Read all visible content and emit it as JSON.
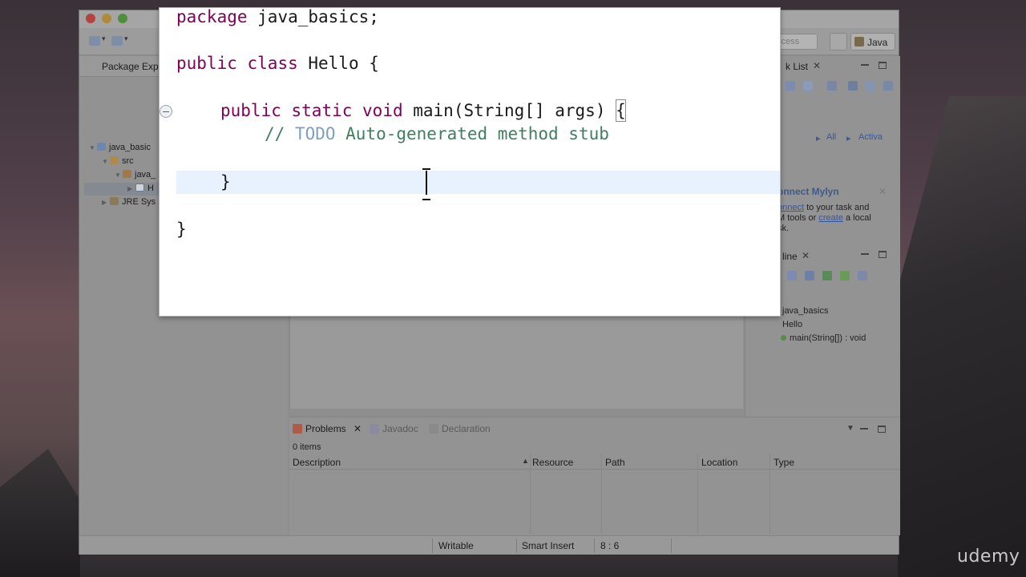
{
  "code": {
    "line1": {
      "keyword": "package",
      "rest": " java_basics;"
    },
    "line2": {
      "kw1": "public",
      "kw2": "class",
      "rest": " Hello {"
    },
    "line3": {
      "kw1": "public",
      "kw2": "static",
      "kw3": "void",
      "rest": " main(String[] args) ",
      "brace": "{"
    },
    "line4": {
      "prefix": "// ",
      "todo": "TODO",
      "rest": " Auto-generated method stub"
    },
    "line5": "}",
    "line6": "}"
  },
  "package_explorer": {
    "tab_label": "Package Expl",
    "items": [
      "java_basic",
      "src",
      "java_",
      "H",
      "JRE Sys"
    ]
  },
  "right_views": {
    "task_list_label": "k List",
    "filter_all": "All",
    "filter_activate": "Activa",
    "mylyn_title": "onnect Mylyn",
    "mylyn_connect": "onnect",
    "mylyn_text1": " to your task and",
    "mylyn_text2": "M tools or ",
    "mylyn_create": "create",
    "mylyn_text3": " a local",
    "mylyn_text4": "sk.",
    "outline_label": "line",
    "outline_items": [
      "java_basics",
      "Hello",
      "main(String[]) : void"
    ]
  },
  "toolbar": {
    "quick_access": "ccess",
    "perspective_java": "Java"
  },
  "problems": {
    "tabs": [
      "Problems",
      "Javadoc",
      "Declaration"
    ],
    "count": "0 items",
    "columns": [
      "Description",
      "Resource",
      "Path",
      "Location",
      "Type"
    ]
  },
  "statusbar": {
    "writable": "Writable",
    "insert_mode": "Smart Insert",
    "position": "8 : 6"
  },
  "watermark": "udemy",
  "colors": {
    "keyword": "#7f0055",
    "comment": "#3f7f5f",
    "todo": "#7f9fbf",
    "current_line": "#e8f2fe"
  }
}
